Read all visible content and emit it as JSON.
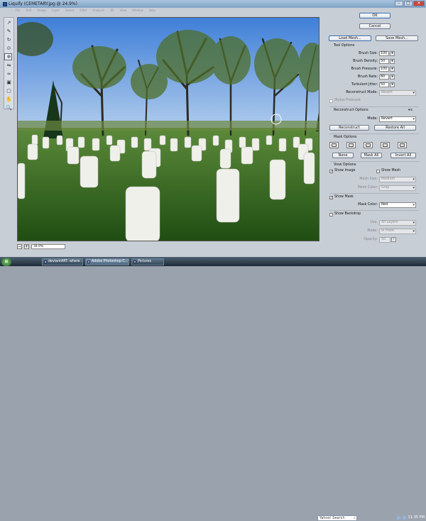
{
  "window": {
    "title": "Liquify (CEMETARY.jpg @ 24.9%)",
    "controls": {
      "minimize": "–",
      "maximize": "□",
      "close": "✕"
    }
  },
  "menubar": {
    "items": [
      "File",
      "Edit",
      "Image",
      "Layer",
      "Select",
      "Filter",
      "Analysis",
      "3D",
      "View",
      "Window",
      "Help"
    ]
  },
  "toolbox": {
    "icons": [
      "forward-warp",
      "reconstruct",
      "twirl",
      "pucker",
      "bloat",
      "push-left",
      "mirror",
      "turbulence",
      "freeze-mask",
      "thaw-mask",
      "hand",
      "zoom"
    ],
    "selected_index": 4
  },
  "status": {
    "zoom_minus": "−",
    "zoom_plus": "+",
    "zoom_value": "34.9%"
  },
  "panel": {
    "ok": "OK",
    "cancel": "Cancel",
    "load_mesh": "Load Mesh...",
    "save_mesh": "Save Mesh...",
    "tool_options": {
      "heading": "Tool Options",
      "rows": [
        {
          "label": "Brush Size:",
          "value": "100"
        },
        {
          "label": "Brush Density:",
          "value": "50"
        },
        {
          "label": "Brush Pressure:",
          "value": "100"
        },
        {
          "label": "Brush Rate:",
          "value": "80"
        },
        {
          "label": "Turbulent Jitter:",
          "value": "50"
        }
      ],
      "reconstruct_mode_label": "Reconstruct Mode:",
      "reconstruct_mode_value": "Revert",
      "stylus_pressure": "Stylus Pressure"
    },
    "reconstruct_options": {
      "heading": "Reconstruct Options",
      "mode_label": "Mode:",
      "mode_value": "Revert",
      "reconstruct": "Reconstruct",
      "restore_all": "Restore All"
    },
    "mask_options": {
      "heading": "Mask Options",
      "none": "None",
      "mask_all": "Mask All",
      "invert_all": "Invert All"
    },
    "view_options": {
      "heading": "View Options",
      "show_image": "Show Image",
      "show_mesh": "Show Mesh",
      "mesh_size_label": "Mesh Size:",
      "mesh_size_value": "Medium",
      "mesh_color_label": "Mesh Color:",
      "mesh_color_value": "Gray",
      "show_mask": "Show Mask",
      "mask_color_label": "Mask Color:",
      "mask_color_value": "Red",
      "show_backdrop": "Show Backdrop",
      "use_label": "Use:",
      "use_value": "All Layers",
      "mode_label": "Mode:",
      "mode_value": "In Front",
      "opacity_label": "Opacity:",
      "opacity_value": "50",
      "checked": "✓"
    }
  },
  "taskbar": {
    "start": "⊞",
    "items": [
      "deviantART: where ...",
      "Adobe Photoshop C...",
      "Pictures"
    ],
    "active_index": 1,
    "search_placeholder": "Yahoo! Search",
    "time": "11:35 PM"
  },
  "colors": {
    "sky": "#6fa1e3",
    "grass": "#2f6a1c",
    "title_gradient_top": "#a9c3de"
  }
}
